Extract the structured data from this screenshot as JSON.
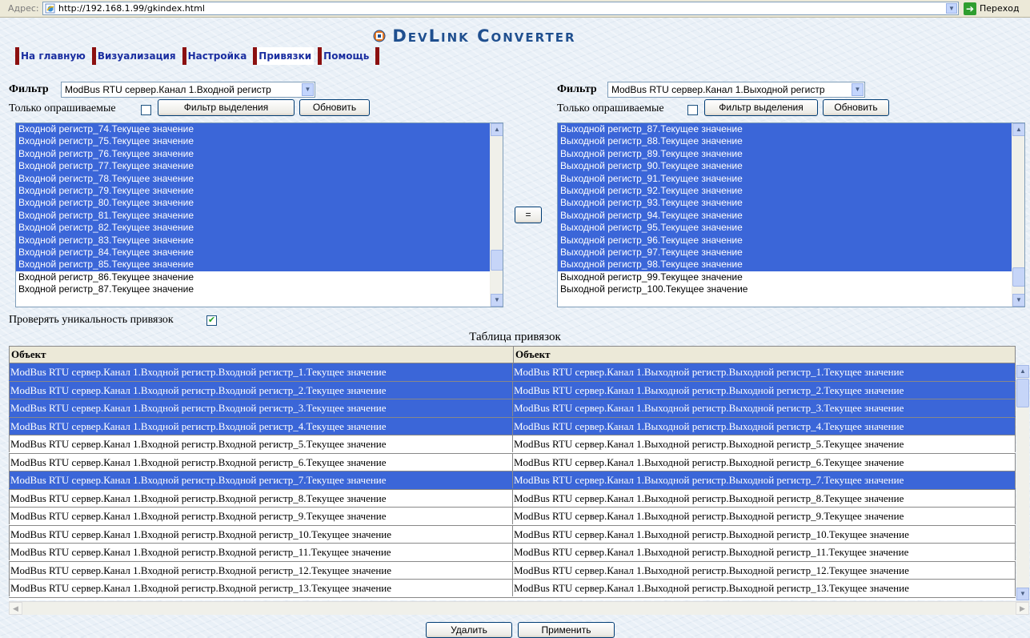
{
  "addressbar": {
    "label": "Адрес:",
    "url": "http://192.168.1.99/gkindex.html",
    "go_label": "Переход"
  },
  "header": {
    "brand": "DevLink Converter"
  },
  "nav": {
    "items": [
      {
        "label": "На главную"
      },
      {
        "label": "Визуализация"
      },
      {
        "label": "Настройка"
      },
      {
        "label": "Привязки"
      },
      {
        "label": "Помощь"
      }
    ]
  },
  "left_panel": {
    "filter_label": "Фильтр",
    "filter_value": "ModBus RTU сервер.Канал 1.Входной регистр",
    "only_polled_label": "Только опрашиваемые",
    "filter_selection_button": "Фильтр выделения",
    "refresh_button": "Обновить",
    "items": [
      "Входной регистр_74.Текущее значение",
      "Входной регистр_75.Текущее значение",
      "Входной регистр_76.Текущее значение",
      "Входной регистр_77.Текущее значение",
      "Входной регистр_78.Текущее значение",
      "Входной регистр_79.Текущее значение",
      "Входной регистр_80.Текущее значение",
      "Входной регистр_81.Текущее значение",
      "Входной регистр_82.Текущее значение",
      "Входной регистр_83.Текущее значение",
      "Входной регистр_84.Текущее значение",
      "Входной регистр_85.Текущее значение",
      "Входной регистр_86.Текущее значение",
      "Входной регистр_87.Текущее значение"
    ],
    "selected_count": 12
  },
  "right_panel": {
    "filter_label": "Фильтр",
    "filter_value": "ModBus RTU сервер.Канал 1.Выходной регистр",
    "only_polled_label": "Только опрашиваемые",
    "filter_selection_button": "Фильтр выделения",
    "refresh_button": "Обновить",
    "items": [
      "Выходной регистр_87.Текущее значение",
      "Выходной регистр_88.Текущее значение",
      "Выходной регистр_89.Текущее значение",
      "Выходной регистр_90.Текущее значение",
      "Выходной регистр_91.Текущее значение",
      "Выходной регистр_92.Текущее значение",
      "Выходной регистр_93.Текущее значение",
      "Выходной регистр_94.Текущее значение",
      "Выходной регистр_95.Текущее значение",
      "Выходной регистр_96.Текущее значение",
      "Выходной регистр_97.Текущее значение",
      "Выходной регистр_98.Текущее значение",
      "Выходной регистр_99.Текущее значение",
      "Выходной регистр_100.Текущее значение"
    ],
    "selected_count": 12
  },
  "bind_button": "=",
  "check_unique_label": "Проверять уникальность привязок",
  "check_unique_checked": true,
  "table": {
    "title": "Таблица привязок",
    "headers": [
      "Объект",
      "Объект"
    ],
    "rows": [
      {
        "a": "ModBus RTU сервер.Канал 1.Входной регистр.Входной регистр_1.Текущее значение",
        "b": "ModBus RTU сервер.Канал 1.Выходной регистр.Выходной регистр_1.Текущее значение",
        "selected": true
      },
      {
        "a": "ModBus RTU сервер.Канал 1.Входной регистр.Входной регистр_2.Текущее значение",
        "b": "ModBus RTU сервер.Канал 1.Выходной регистр.Выходной регистр_2.Текущее значение",
        "selected": true
      },
      {
        "a": "ModBus RTU сервер.Канал 1.Входной регистр.Входной регистр_3.Текущее значение",
        "b": "ModBus RTU сервер.Канал 1.Выходной регистр.Выходной регистр_3.Текущее значение",
        "selected": true
      },
      {
        "a": "ModBus RTU сервер.Канал 1.Входной регистр.Входной регистр_4.Текущее значение",
        "b": "ModBus RTU сервер.Канал 1.Выходной регистр.Выходной регистр_4.Текущее значение",
        "selected": true
      },
      {
        "a": "ModBus RTU сервер.Канал 1.Входной регистр.Входной регистр_5.Текущее значение",
        "b": "ModBus RTU сервер.Канал 1.Выходной регистр.Выходной регистр_5.Текущее значение",
        "selected": false
      },
      {
        "a": "ModBus RTU сервер.Канал 1.Входной регистр.Входной регистр_6.Текущее значение",
        "b": "ModBus RTU сервер.Канал 1.Выходной регистр.Выходной регистр_6.Текущее значение",
        "selected": false
      },
      {
        "a": "ModBus RTU сервер.Канал 1.Входной регистр.Входной регистр_7.Текущее значение",
        "b": "ModBus RTU сервер.Канал 1.Выходной регистр.Выходной регистр_7.Текущее значение",
        "selected": true
      },
      {
        "a": "ModBus RTU сервер.Канал 1.Входной регистр.Входной регистр_8.Текущее значение",
        "b": "ModBus RTU сервер.Канал 1.Выходной регистр.Выходной регистр_8.Текущее значение",
        "selected": false
      },
      {
        "a": "ModBus RTU сервер.Канал 1.Входной регистр.Входной регистр_9.Текущее значение",
        "b": "ModBus RTU сервер.Канал 1.Выходной регистр.Выходной регистр_9.Текущее значение",
        "selected": false
      },
      {
        "a": "ModBus RTU сервер.Канал 1.Входной регистр.Входной регистр_10.Текущее значение",
        "b": "ModBus RTU сервер.Канал 1.Выходной регистр.Выходной регистр_10.Текущее значение",
        "selected": false
      },
      {
        "a": "ModBus RTU сервер.Канал 1.Входной регистр.Входной регистр_11.Текущее значение",
        "b": "ModBus RTU сервер.Канал 1.Выходной регистр.Выходной регистр_11.Текущее значение",
        "selected": false
      },
      {
        "a": "ModBus RTU сервер.Канал 1.Входной регистр.Входной регистр_12.Текущее значение",
        "b": "ModBus RTU сервер.Канал 1.Выходной регистр.Выходной регистр_12.Текущее значение",
        "selected": false
      },
      {
        "a": "ModBus RTU сервер.Канал 1.Входной регистр.Входной регистр_13.Текущее значение",
        "b": "ModBus RTU сервер.Канал 1.Выходной регистр.Выходной регистр_13.Текущее значение",
        "selected": false
      }
    ]
  },
  "actions": {
    "delete_button": "Удалить",
    "apply_button": "Применить"
  },
  "colors": {
    "selection": "#3b66d8",
    "nav_bar": "#8b1010",
    "nav_text": "#1a2ea0",
    "brand": "#1f4f8f"
  }
}
